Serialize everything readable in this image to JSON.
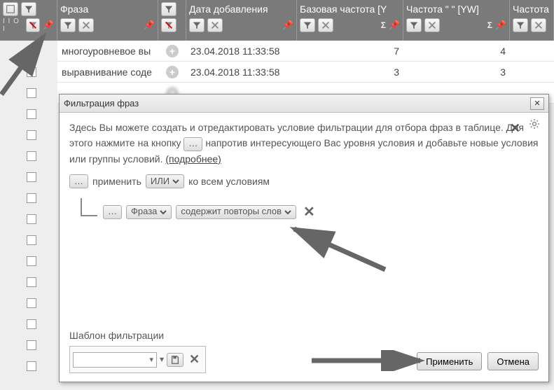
{
  "header": {
    "cols": {
      "phrase": "Фраза",
      "date_added": "Дата добавления",
      "base_freq": "Базовая частота [Y",
      "freq_yw": "Частота \" \" [YW]",
      "freq_last": "Частота"
    }
  },
  "rows": [
    {
      "phrase": "многоуровневое вы",
      "date": "23.04.2018 11:33:58",
      "base": "7",
      "yw": "4"
    },
    {
      "phrase": "выравнивание соде",
      "date": "23.04.2018 11:33:58",
      "base": "3",
      "yw": "3"
    },
    {
      "phrase": "",
      "date": "",
      "base": "",
      "yw": ""
    }
  ],
  "dialog": {
    "title": "Фильтрация фраз",
    "intro1": "Здесь Вы можете создать и отредактировать условие фильтрации для отбора фраз в таблице. Для этого нажмите на кнопку",
    "intro2": "напротив интересующего Вас уровня условия и добавьте новые условия или группы условий.",
    "more_link": "(подробнее)",
    "apply_word": "применить",
    "logic_op": "ИЛИ",
    "to_all": "ко всем условиям",
    "cond_field": "Фраза",
    "cond_op": "содержит повторы слов",
    "template_label": "Шаблон фильтрации",
    "btn_apply": "Применить",
    "btn_cancel": "Отмена"
  }
}
